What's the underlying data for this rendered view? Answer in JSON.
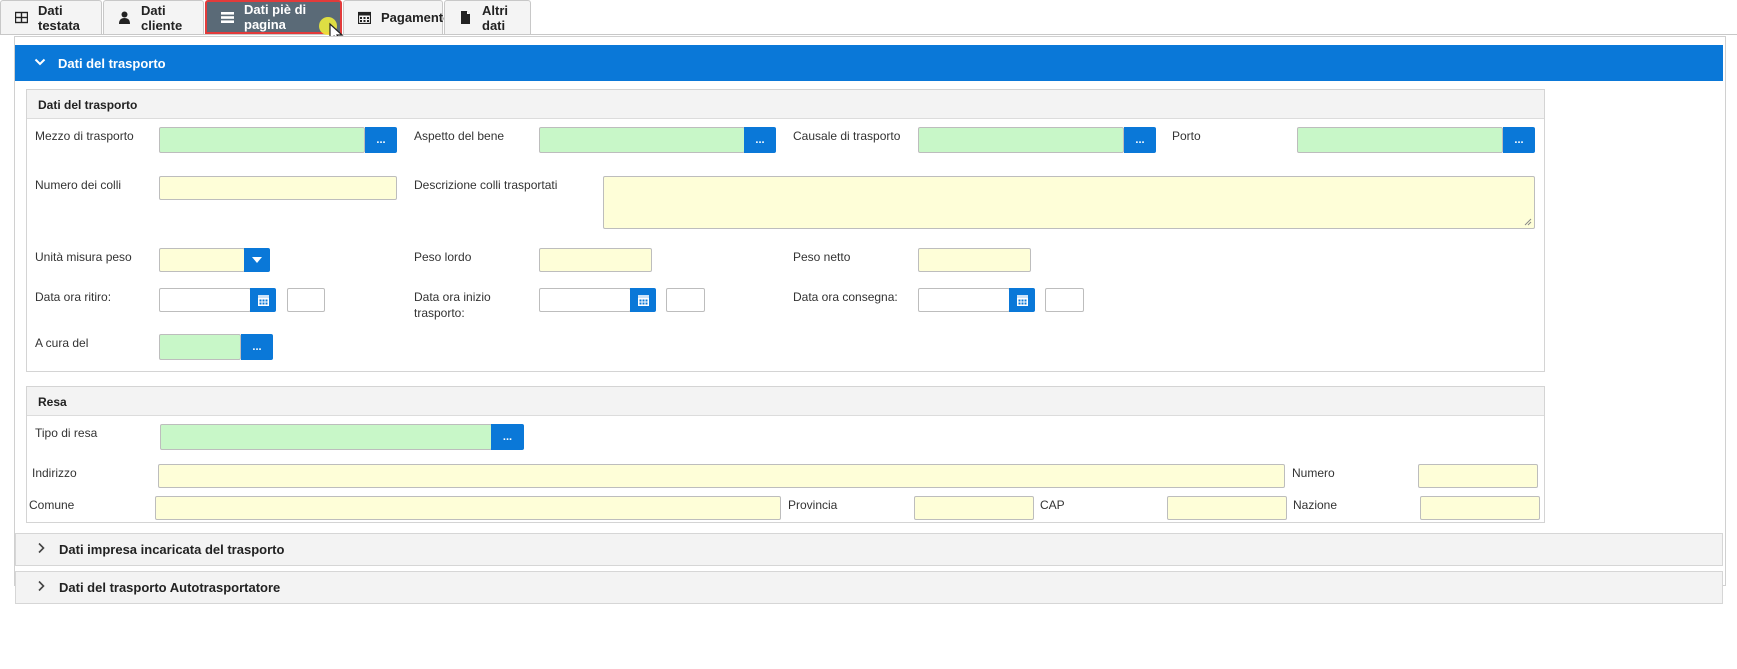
{
  "tabs": [
    {
      "label": "Dati testata",
      "icon": "table-icon"
    },
    {
      "label": "Dati cliente",
      "icon": "user-icon"
    },
    {
      "label": "Dati piè di pagina",
      "icon": "list-icon"
    },
    {
      "label": "Pagamento",
      "icon": "calendar-icon"
    },
    {
      "label": "Altri dati",
      "icon": "file-icon"
    }
  ],
  "active_tab": "Dati piè di pagina",
  "colors": {
    "accent": "#0a78d8",
    "required_green": "#c8f7c8",
    "optional_yellow": "#fefed8",
    "active_tab": "#5a6a77"
  },
  "accordion": {
    "transport_header": "Dati del trasporto",
    "company_header": "Dati impresa incaricata del trasporto",
    "carrier_header": "Dati del trasporto Autotrasportatore"
  },
  "transport": {
    "title": "Dati del trasporto",
    "mezzo": "Mezzo di trasporto",
    "aspetto": "Aspetto del bene",
    "causale": "Causale di trasporto",
    "porto": "Porto",
    "numero_colli": "Numero dei colli",
    "descrizione_colli": "Descrizione colli trasportati",
    "unita_peso": "Unità misura peso",
    "peso_lordo": "Peso lordo",
    "peso_netto": "Peso netto",
    "data_ritiro": "Data ora ritiro:",
    "data_inizio_1": "Data ora inizio",
    "data_inizio_2": "trasporto:",
    "data_consegna": "Data ora consegna:",
    "a_cura": "A cura del",
    "lookup_label": "..."
  },
  "resa": {
    "title": "Resa",
    "tipo": "Tipo di resa",
    "indirizzo": "Indirizzo",
    "numero": "Numero",
    "comune": "Comune",
    "provincia": "Provincia",
    "cap": "CAP",
    "nazione": "Nazione"
  }
}
